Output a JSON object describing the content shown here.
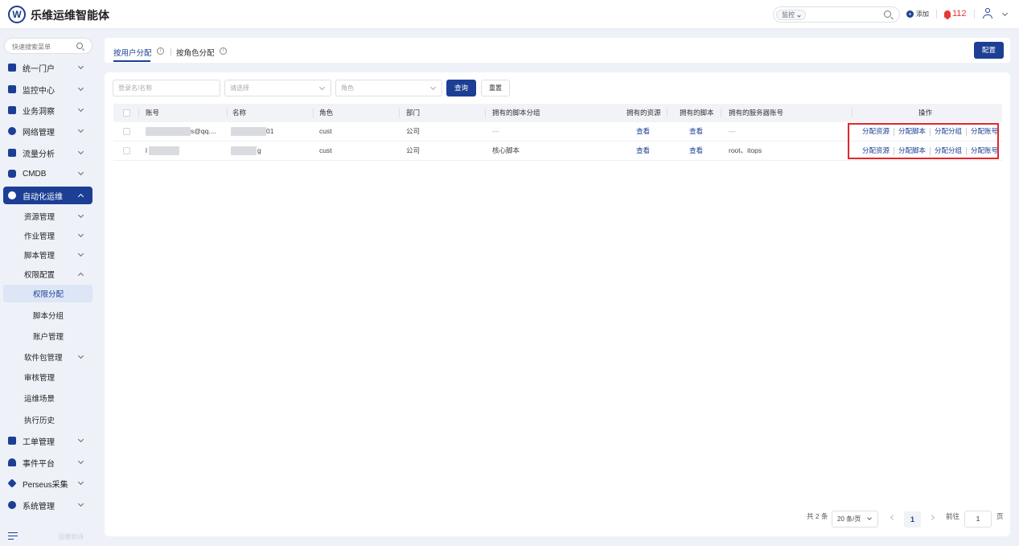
{
  "header": {
    "logo_letter": "W",
    "title": "乐维运维智能体",
    "search_scope": "监控",
    "add_label": "添加",
    "alert_count": "112"
  },
  "sidebar": {
    "search_placeholder": "快速搜索菜单",
    "menu": [
      {
        "label": "统一门户",
        "icon": "home-icon"
      },
      {
        "label": "监控中心",
        "icon": "monitor-icon"
      },
      {
        "label": "业务洞察",
        "icon": "insight-icon"
      },
      {
        "label": "网络管理",
        "icon": "globe-icon"
      },
      {
        "label": "流量分析",
        "icon": "traffic-icon"
      },
      {
        "label": "CMDB",
        "icon": "cube-icon"
      },
      {
        "label": "自动化运维",
        "icon": "automation-icon"
      }
    ],
    "sub": [
      {
        "label": "资源管理"
      },
      {
        "label": "作业管理"
      },
      {
        "label": "脚本管理"
      },
      {
        "label": "权限配置"
      },
      {
        "label": "权限分配"
      },
      {
        "label": "脚本分组"
      },
      {
        "label": "账户管理"
      },
      {
        "label": "软件包管理"
      },
      {
        "label": "审核管理"
      },
      {
        "label": "运维场景"
      },
      {
        "label": "执行历史"
      }
    ],
    "bottom_menu": [
      {
        "label": "工单管理",
        "icon": "ticket-icon"
      },
      {
        "label": "事件平台",
        "icon": "bell-icon"
      },
      {
        "label": "Perseus采集",
        "icon": "diamond-icon"
      },
      {
        "label": "系统管理",
        "icon": "gear-icon"
      }
    ],
    "footer": "运维如诗"
  },
  "tabs": {
    "by_user": "按用户分配",
    "by_role": "按角色分配",
    "config_button": "配置"
  },
  "filters": {
    "account_placeholder": "登录名/名称",
    "select_placeholder": "请选择",
    "role_placeholder": "角色",
    "query_button": "查询",
    "reset_button": "重置"
  },
  "table": {
    "columns": [
      "账号",
      "名称",
      "角色",
      "部门",
      "拥有的脚本分组",
      "拥有的资源",
      "拥有的脚本",
      "拥有的服务器账号",
      "操作"
    ],
    "rows": [
      {
        "account": "s@qq....",
        "name": "01",
        "role": "cust",
        "dept": "公司",
        "script_group": "—",
        "resource": "查看",
        "script": "查看",
        "server_account": "—"
      },
      {
        "account": "l",
        "name": "g",
        "role": "cust",
        "dept": "公司",
        "script_group": "核心脚本",
        "resource": "查看",
        "script": "查看",
        "server_account": "root、itops"
      }
    ],
    "ops": [
      "分配资源",
      "分配脚本",
      "分配分组",
      "分配账号"
    ]
  },
  "pagination": {
    "total": "共 2 条",
    "page_size": "20 条/页",
    "current_page": "1",
    "goto_label": "前往",
    "goto_value": "1",
    "page_suffix": "页"
  }
}
